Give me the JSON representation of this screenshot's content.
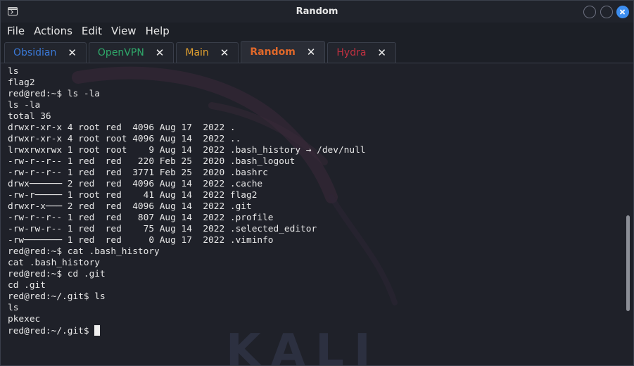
{
  "window": {
    "title": "Random"
  },
  "menu": [
    "File",
    "Actions",
    "Edit",
    "View",
    "Help"
  ],
  "tabs": [
    {
      "label": "Obsidian",
      "color": "#3a78d6",
      "active": false
    },
    {
      "label": "OpenVPN",
      "color": "#2fa86a",
      "active": false
    },
    {
      "label": "Main",
      "color": "#e0a030",
      "active": false
    },
    {
      "label": "Random",
      "color": "#e0682a",
      "active": true
    },
    {
      "label": "Hydra",
      "color": "#c03040",
      "active": false
    }
  ],
  "tab_close_glyph": "✕",
  "terminal": {
    "lines": [
      "ls",
      "flag2",
      "red@red:~$ ls -la",
      "ls -la",
      "total 36",
      "drwxr-xr-x 4 root red  4096 Aug 17  2022 .",
      "drwxr-xr-x 4 root root 4096 Aug 14  2022 ..",
      "lrwxrwxrwx 1 root root    9 Aug 14  2022 .bash_history → /dev/null",
      "-rw-r--r-- 1 red  red   220 Feb 25  2020 .bash_logout",
      "-rw-r--r-- 1 red  red  3771 Feb 25  2020 .bashrc",
      "drwx────── 2 red  red  4096 Aug 14  2022 .cache",
      "-rw-r───── 1 root red    41 Aug 14  2022 flag2",
      "drwxr-x─── 2 red  red  4096 Aug 14  2022 .git",
      "-rw-r--r-- 1 red  red   807 Aug 14  2022 .profile",
      "-rw-rw-r-- 1 red  red    75 Aug 14  2022 .selected_editor",
      "-rw─────── 1 red  red     0 Aug 17  2022 .viminfo",
      "red@red:~$ cat .bash_history",
      "cat .bash_history",
      "red@red:~$ cd .git",
      "cd .git",
      "red@red:~/.git$ ls",
      "ls",
      "pkexec"
    ],
    "prompt": "red@red:~/.git$ "
  },
  "watermark": {
    "text": "KALI"
  }
}
